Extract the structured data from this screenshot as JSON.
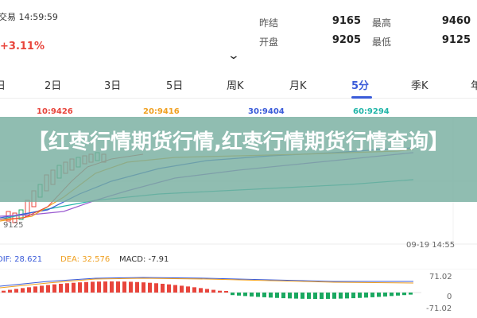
{
  "header": {
    "time_text": "交易 14:59:59",
    "change_text": "+3.11%",
    "quotes": [
      {
        "label": "昨结",
        "value": "9165"
      },
      {
        "label": "最高",
        "value": "9460"
      },
      {
        "label": "开盘",
        "value": "9205"
      },
      {
        "label": "最低",
        "value": "9125"
      }
    ]
  },
  "tabs": [
    {
      "label": "日",
      "active": false
    },
    {
      "label": "2日",
      "active": false
    },
    {
      "label": "3日",
      "active": false
    },
    {
      "label": "5日",
      "active": false
    },
    {
      "label": "周K",
      "active": false
    },
    {
      "label": "月K",
      "active": false
    },
    {
      "label": "5分",
      "active": true
    },
    {
      "label": "季K",
      "active": false
    },
    {
      "label": "年",
      "active": false
    }
  ],
  "ma_legend": [
    {
      "text": "10:9426",
      "color": "#e8453c"
    },
    {
      "text": "20:9416",
      "color": "#f0a020"
    },
    {
      "text": "30:9404",
      "color": "#3a5bd9"
    },
    {
      "text": "60:9294",
      "color": "#20b5a8"
    }
  ],
  "chart": {
    "low_label": "9125",
    "time_right": "09-19 14:55"
  },
  "macd": {
    "legend": [
      {
        "text": "DIF: 28.621",
        "color": "#3a5bd9"
      },
      {
        "text": "DEA: 32.576",
        "color": "#f0a020"
      },
      {
        "text": "MACD: -7.91",
        "color": "#333333"
      }
    ],
    "axis_top": "71.02",
    "axis_mid": "0",
    "axis_bottom": "-71.02"
  },
  "banner": {
    "title": "【红枣行情期货行情,红枣行情期货行情查询】"
  },
  "colors": {
    "up": "#e8453c",
    "down": "#1aa860",
    "accent": "#3a5bd9",
    "banner_bg": "#78afa0"
  },
  "icons": {
    "expand": "chevron-down-icon"
  }
}
